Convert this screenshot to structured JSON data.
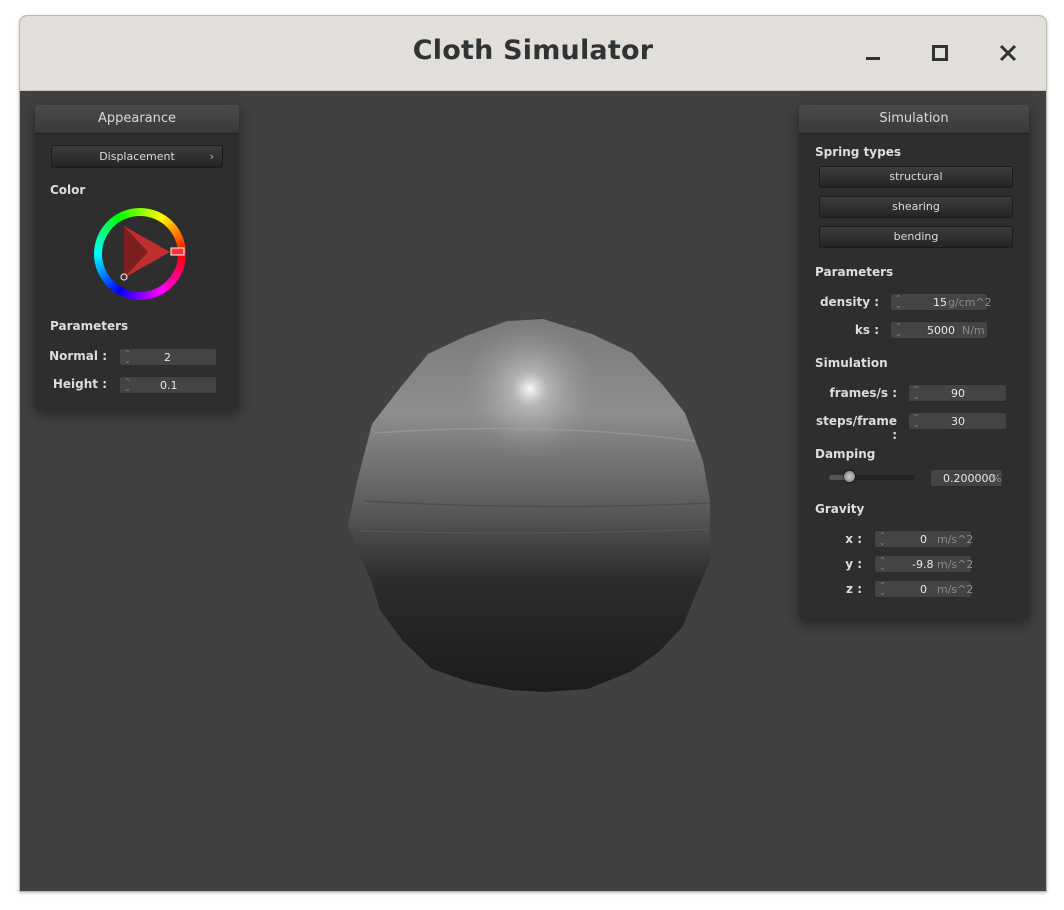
{
  "window": {
    "title": "Cloth Simulator",
    "controls": {
      "minimize": "minimize-icon",
      "maximize": "maximize-icon",
      "close": "close-icon"
    }
  },
  "appearance": {
    "header": "Appearance",
    "shader_select": "Displacement",
    "color_label": "Color",
    "parameters_label": "Parameters",
    "normal_label": "Normal :",
    "normal_value": "2",
    "height_label": "Height :",
    "height_value": "0.1",
    "selected_color": "#ff3030"
  },
  "simulation": {
    "header": "Simulation",
    "spring_types_label": "Spring types",
    "spring_buttons": [
      "structural",
      "shearing",
      "bending"
    ],
    "parameters_label": "Parameters",
    "density_label": "density :",
    "density_value": "15",
    "density_unit": "g/cm^2",
    "ks_label": "ks :",
    "ks_value": "5000",
    "ks_unit": "N/m",
    "simulation_label": "Simulation",
    "frames_label": "frames/s :",
    "frames_value": "90",
    "steps_label": "steps/frame :",
    "steps_value": "30",
    "damping_label": "Damping",
    "damping_value": "0.200000",
    "damping_unit": "%",
    "damping_slider_fraction": 0.2,
    "gravity_label": "Gravity",
    "gx_label": "x :",
    "gx_value": "0",
    "gy_label": "y :",
    "gy_value": "-9.8",
    "gz_label": "z :",
    "gz_value": "0",
    "gravity_unit": "m/s^2"
  }
}
